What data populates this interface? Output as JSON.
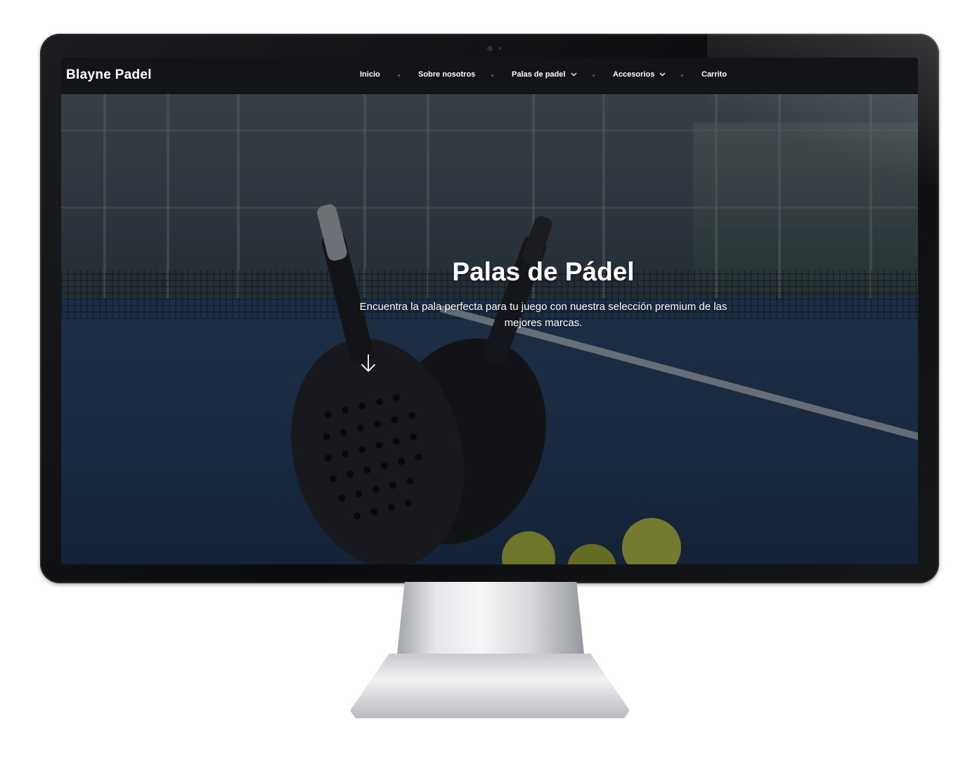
{
  "navbar": {
    "brand": "Blayne Padel",
    "items": [
      {
        "label": "Inicio",
        "has_dropdown": false
      },
      {
        "label": "Sobre nosotros",
        "has_dropdown": false
      },
      {
        "label": "Palas de padel",
        "has_dropdown": true
      },
      {
        "label": "Accesorios",
        "has_dropdown": true
      },
      {
        "label": "Carrito",
        "has_dropdown": false
      }
    ]
  },
  "hero": {
    "title": "Palas de Pádel",
    "subtitle": "Encuentra la pala perfecta para tu juego con nuestra selección premium de las mejores marcas.",
    "scroll_icon": "arrow-down-icon"
  },
  "colors": {
    "navbar_bg": "#121418",
    "text": "#ffffff",
    "court_blue": "#2a4568",
    "ball_yellow": "#c8d24a"
  }
}
